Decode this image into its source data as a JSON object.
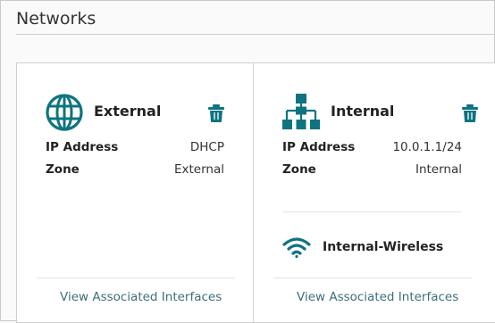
{
  "page": {
    "title": "Networks"
  },
  "colors": {
    "accent": "#0e7480",
    "link": "#3b6f7d"
  },
  "cards": [
    {
      "name": "External",
      "icon": "globe-icon",
      "fields": [
        {
          "label": "IP Address",
          "value": "DHCP"
        },
        {
          "label": "Zone",
          "value": "External"
        }
      ],
      "link": "View Associated Interfaces"
    },
    {
      "name": "Internal",
      "icon": "network-tree-icon",
      "fields": [
        {
          "label": "IP Address",
          "value": "10.0.1.1/24"
        },
        {
          "label": "Zone",
          "value": "Internal"
        }
      ],
      "wireless": {
        "name": "Internal-Wireless",
        "icon": "wifi-icon"
      },
      "link": "View Associated Interfaces"
    }
  ]
}
